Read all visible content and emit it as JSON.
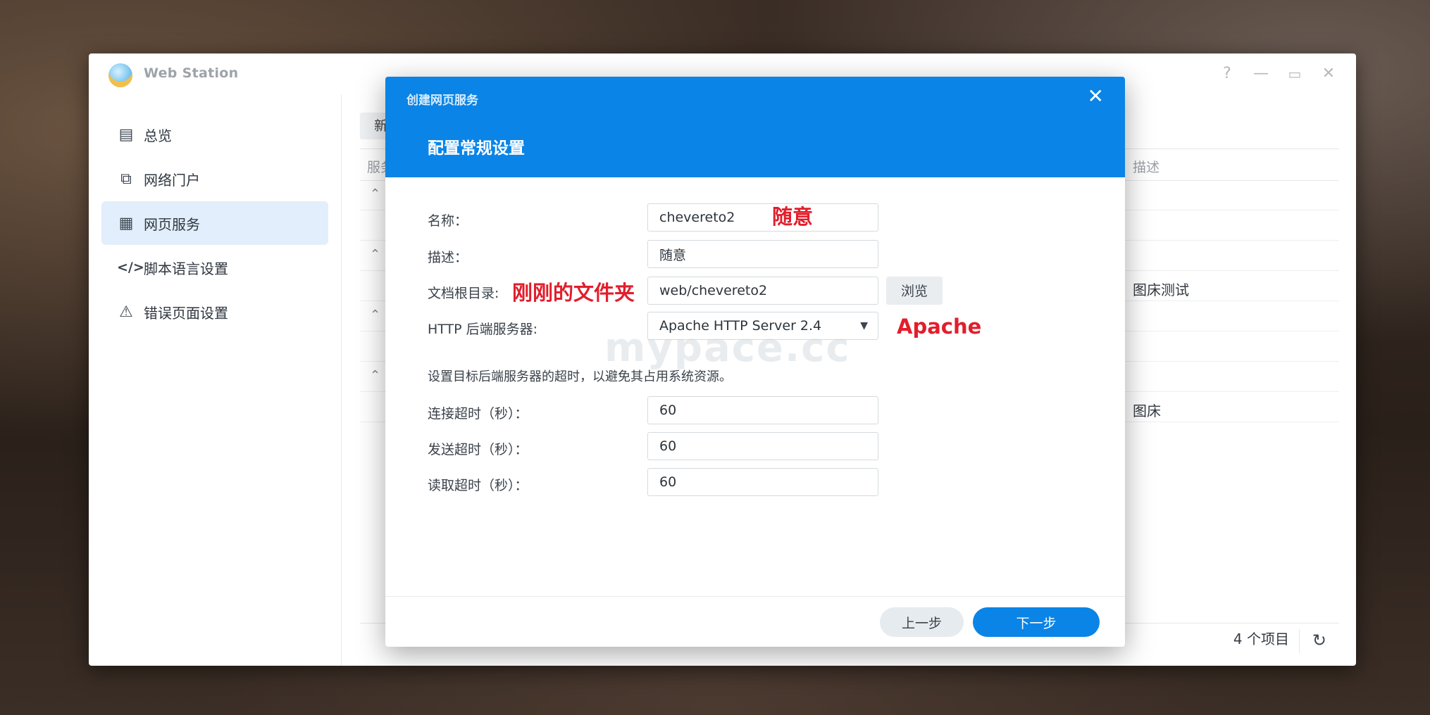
{
  "window": {
    "title": "Web Station",
    "controls": {
      "help": "?",
      "minimize": "—",
      "maximize": "▭",
      "close": "✕"
    }
  },
  "sidebar": {
    "items": [
      {
        "label": "总览",
        "icon": "overview-icon"
      },
      {
        "label": "网络门户",
        "icon": "portal-icon"
      },
      {
        "label": "网页服务",
        "icon": "web-service-icon",
        "active": true
      },
      {
        "label": "脚本语言设置",
        "icon": "code-icon"
      },
      {
        "label": "错误页面设置",
        "icon": "error-icon"
      }
    ]
  },
  "content": {
    "new_button": "新",
    "column_service": "服务",
    "column_desc": "描述",
    "row_desc_1": "图床测试",
    "row_desc_2": "图床",
    "item_count": "4 个项目"
  },
  "dialog": {
    "small_title": "创建网页服务",
    "title": "配置常规设置",
    "fields": {
      "name_label": "名称：",
      "name_value": "chevereto2",
      "desc_label": "描述：",
      "desc_value": "随意",
      "root_label": "文档根目录:",
      "root_value": "web/chevereto2",
      "browse": "浏览",
      "backend_label": "HTTP 后端服务器:",
      "backend_value": "Apache HTTP Server 2.4",
      "hint": "设置目标后端服务器的超时，以避免其占用系统资源。",
      "connect_label": "连接超时（秒）：",
      "connect_value": "60",
      "send_label": "发送超时（秒）：",
      "send_value": "60",
      "read_label": "读取超时（秒）：",
      "read_value": "60"
    },
    "notes": {
      "name_note": "随意",
      "root_note": "刚刚的文件夹",
      "backend_note": "Apache"
    },
    "buttons": {
      "prev": "上一步",
      "next": "下一步"
    }
  },
  "watermark": "mypace.cc",
  "colors": {
    "accent": "#0a84e6",
    "annotation": "#e21e2c"
  }
}
